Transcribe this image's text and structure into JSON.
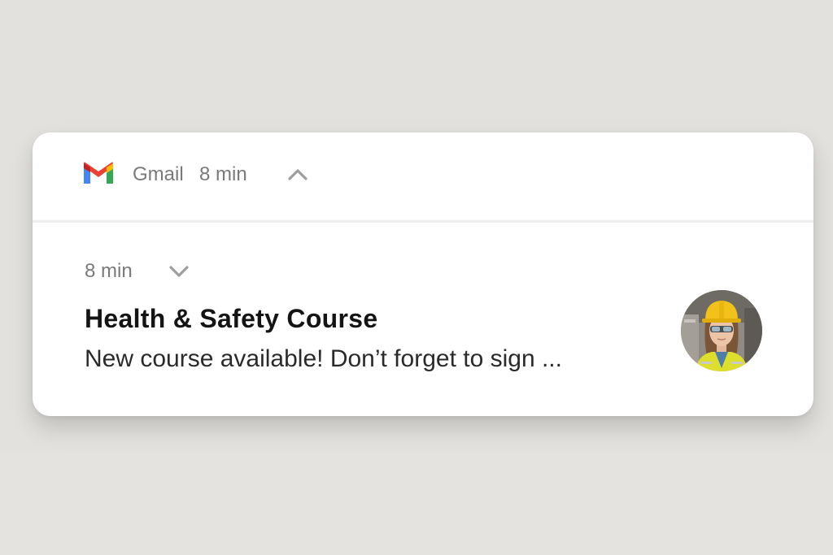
{
  "header": {
    "app_name": "Gmail",
    "time": "8 min",
    "logo_icon": "gmail-logo-icon",
    "toggle_icon": "chevron-up-icon"
  },
  "message": {
    "time": "8 min",
    "toggle_icon": "chevron-down-icon",
    "title": "Health & Safety Course",
    "body": "New course available! Don’t forget to sign ...",
    "avatar": "sender-avatar-worker-with-hard-hat"
  },
  "colors": {
    "page_background": "#e4e3e0",
    "card_background": "#ffffff",
    "muted_text": "#7a7a7a",
    "title_text": "#141414",
    "body_text": "#2a2a2a",
    "gmail_blue": "#4285F4",
    "gmail_red": "#EA4335",
    "gmail_yellow": "#FBBC04",
    "gmail_green": "#34A853"
  }
}
